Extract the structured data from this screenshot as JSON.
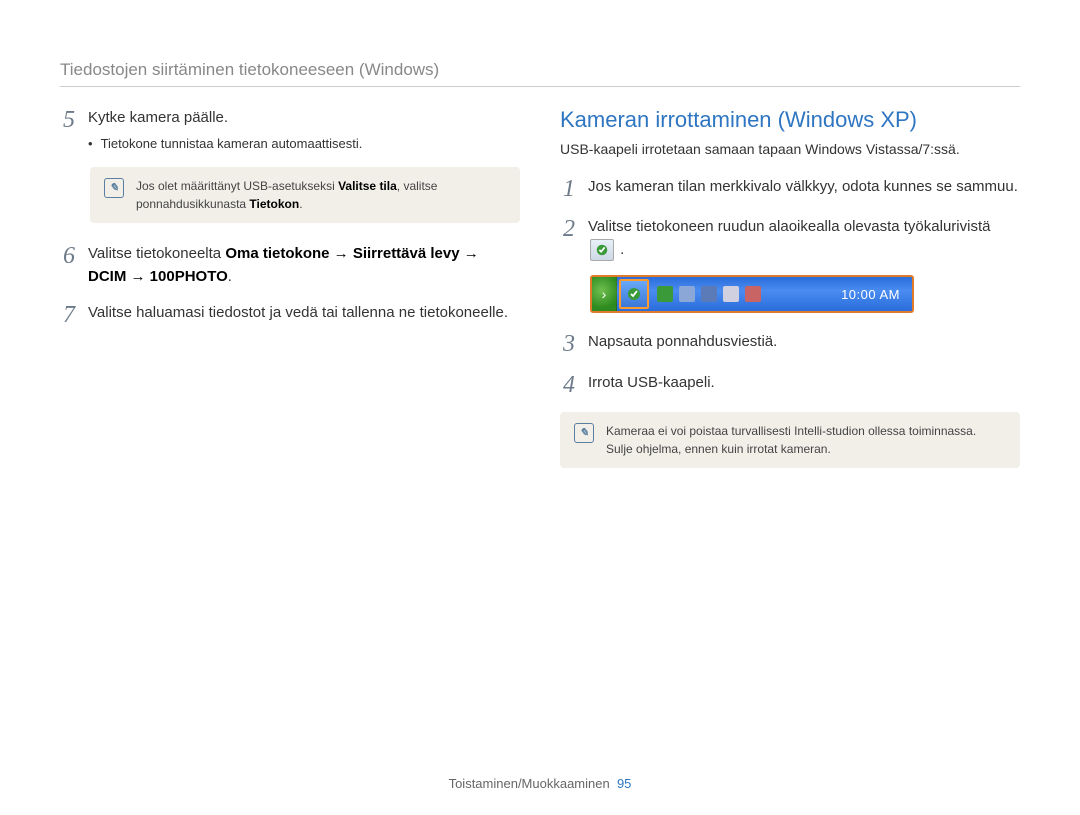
{
  "header": {
    "title": "Tiedostojen siirtäminen tietokoneeseen (Windows)"
  },
  "left": {
    "step5": {
      "text": "Kytke kamera päälle.",
      "bullet": "Tietokone tunnistaa kameran automaattisesti."
    },
    "note1": {
      "pre": "Jos olet määrittänyt USB-asetukseksi ",
      "bold1": "Valitse tila",
      "mid": ", valitse ponnahdusikkunasta ",
      "bold2": "Tietokon",
      "post": "."
    },
    "step6": {
      "pre": "Valitse tietokoneelta ",
      "bold": "Oma tietokone → Siirrettävä levy → DCIM → 100PHOTO",
      "post": "."
    },
    "step7": {
      "text": "Valitse haluamasi tiedostot ja vedä tai tallenna ne tietokoneelle."
    }
  },
  "right": {
    "heading": "Kameran irrottaminen (Windows XP)",
    "sub": "USB-kaapeli irrotetaan samaan tapaan Windows Vistassa/7:ssä.",
    "step1": {
      "text": "Jos kameran tilan merkkivalo välkkyy, odota kunnes se sammuu."
    },
    "step2": {
      "pre": "Valitse tietokoneen ruudun alaoikealla olevasta työkalurivistä ",
      "post": "."
    },
    "taskbar": {
      "clock": "10:00 AM"
    },
    "step3": {
      "text": "Napsauta ponnahdusviestiä."
    },
    "step4": {
      "text": "Irrota USB-kaapeli."
    },
    "note2": {
      "line1": "Kameraa ei voi poistaa turvallisesti Intelli-studion ollessa toiminnassa.",
      "line2": "Sulje ohjelma, ennen kuin irrotat kameran."
    }
  },
  "footer": {
    "section": "Toistaminen/Muokkaaminen",
    "page": "95"
  },
  "nums": {
    "n5": "5",
    "n6": "6",
    "n7": "7",
    "n1": "1",
    "n2": "2",
    "n3": "3",
    "n4": "4"
  }
}
